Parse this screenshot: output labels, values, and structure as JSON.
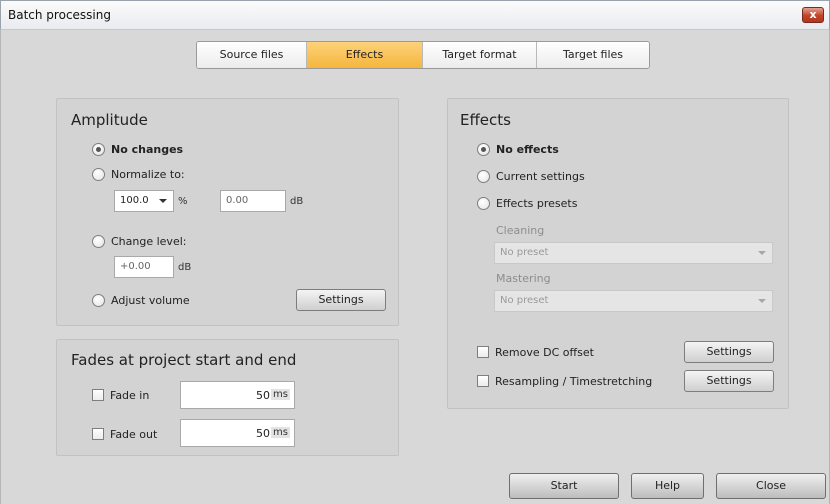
{
  "window": {
    "title": "Batch processing",
    "close_glyph": "x"
  },
  "tabs": [
    {
      "label": "Source files",
      "active": false
    },
    {
      "label": "Effects",
      "active": true
    },
    {
      "label": "Target format",
      "active": false
    },
    {
      "label": "Target files",
      "active": false
    }
  ],
  "amplitude": {
    "title": "Amplitude",
    "no_changes": "No changes",
    "normalize_to": "Normalize to:",
    "normalize_percent_value": "100.0",
    "percent_unit": "%",
    "normalize_db_value": "0.00",
    "db_unit": "dB",
    "change_level": "Change level:",
    "change_level_value": "+0.00",
    "change_level_unit": "dB",
    "adjust_volume": "Adjust volume",
    "settings_label": "Settings"
  },
  "fades": {
    "title": "Fades at project start and end",
    "fade_in_label": "Fade in",
    "fade_in_value": "50",
    "fade_out_label": "Fade out",
    "fade_out_value": "50",
    "unit": "ms"
  },
  "effects": {
    "title": "Effects",
    "no_effects": "No effects",
    "current_settings": "Current settings",
    "effects_presets": "Effects presets",
    "cleaning_label": "Cleaning",
    "cleaning_value": "No preset",
    "mastering_label": "Mastering",
    "mastering_value": "No preset",
    "remove_dc_offset": "Remove DC offset",
    "resampling": "Resampling / Timestretching",
    "settings_label": "Settings"
  },
  "footer": {
    "start_label": "Start",
    "help_label": "Help",
    "close_label": "Close"
  },
  "colors": {
    "active_tab": "#f5b63c",
    "close_button": "#c0432b"
  }
}
